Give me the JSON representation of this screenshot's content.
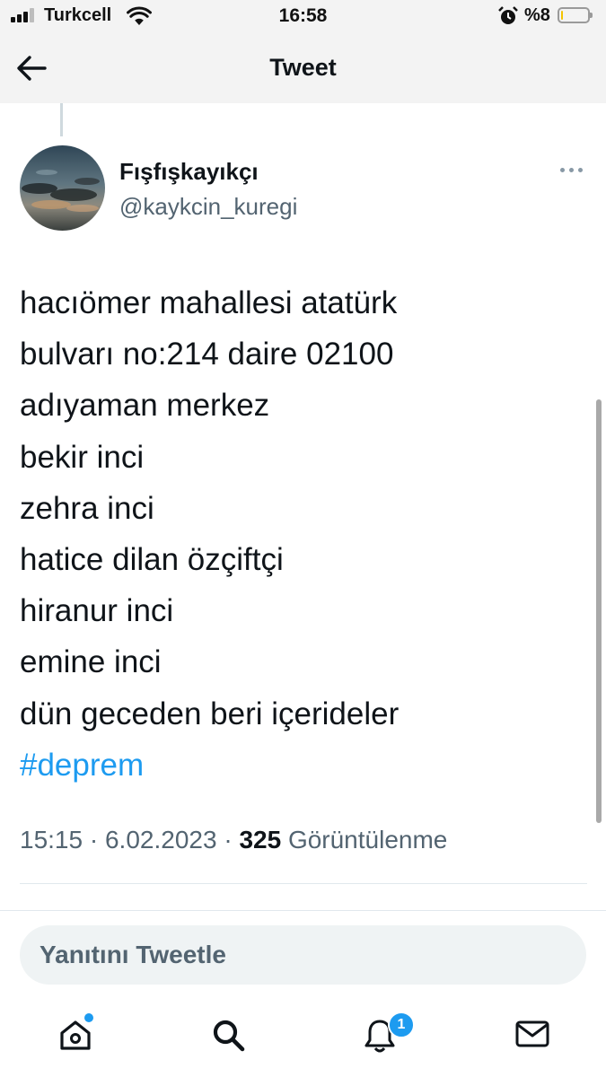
{
  "status_bar": {
    "carrier": "Turkcell",
    "time": "16:58",
    "battery_percent": "%8",
    "battery_level": 0.08,
    "signal_bars_active": 3,
    "battery_color": "#f4c400",
    "icons": [
      "signal-icon",
      "wifi-icon",
      "alarm-icon",
      "battery-icon"
    ]
  },
  "header": {
    "title": "Tweet",
    "back_icon": "arrow-left-icon"
  },
  "tweet": {
    "display_name": "Fışfışkayıkçı",
    "handle": "@kaykcin_kuregi",
    "lines": [
      "hacıömer mahallesi atatürk",
      "bulvarı no:214 daire 02100",
      "adıyaman merkez",
      "bekir inci",
      "zehra inci",
      "hatice dilan özçiftçi",
      "hiranur inci",
      "emine inci",
      "dün geceden beri içerideler"
    ],
    "hashtag": "#deprem",
    "time": "15:15",
    "date": "6.02.2023",
    "views_count": "325",
    "views_label": "Görüntülenme",
    "separator": "·"
  },
  "reply": {
    "placeholder": "Yanıtını Tweetle"
  },
  "tab_bar": {
    "items": [
      "home-icon",
      "search-icon",
      "notifications-icon",
      "messages-icon"
    ],
    "notification_badge": "1"
  },
  "colors": {
    "accent": "#1d9bf0",
    "secondary_text": "#536471",
    "primary_text": "#0f1419"
  }
}
